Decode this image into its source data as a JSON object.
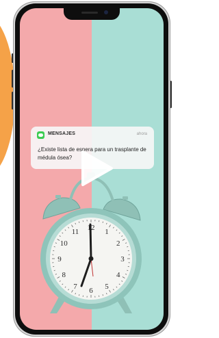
{
  "notification": {
    "app_name": "MENSAJES",
    "time": "ahora",
    "message": "¿Existe lista de espera para un trasplante de médula ósea?",
    "app_icon": "messages-icon"
  },
  "clock": {
    "numbers": [
      "12",
      "1",
      "2",
      "3",
      "4",
      "5",
      "6",
      "7",
      "8",
      "9",
      "10",
      "11"
    ]
  },
  "media": {
    "play_icon": "play-icon"
  },
  "colors": {
    "screen_left": "#f4a9ab",
    "screen_right": "#a9ded5",
    "accent_orange": "#f5a248",
    "messages_green": "#3ccc52"
  }
}
